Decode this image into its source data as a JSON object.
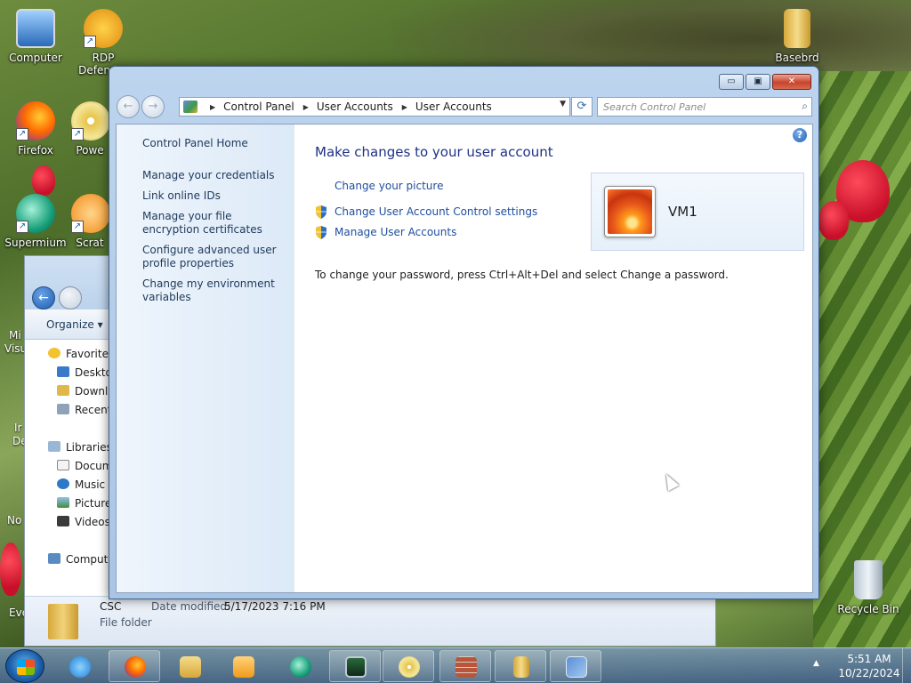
{
  "desktop": {
    "icons": [
      {
        "label": "Computer",
        "icon": "computer-icon"
      },
      {
        "label": "RDP Defender",
        "icon": "rdp-defender-icon"
      },
      {
        "label": "Basebrd",
        "icon": "folder-icon"
      },
      {
        "label": "Firefox",
        "icon": "firefox-icon"
      },
      {
        "label": "Powe",
        "icon": "cd-icon"
      },
      {
        "label": "Supermium",
        "icon": "supermium-icon"
      },
      {
        "label": "Scrat",
        "icon": "scratch-icon"
      },
      {
        "label": "Recycle Bin",
        "icon": "recycle-bin-icon"
      }
    ],
    "edge_labels": [
      "Mi",
      "Visu",
      "Ir",
      "De",
      "No",
      "Eve"
    ]
  },
  "explorer": {
    "organize_label": "Organize",
    "nav_tree": [
      {
        "label": "Favorites",
        "icon": "star-icon"
      },
      {
        "label": "Deskto",
        "icon": "desktop-icon"
      },
      {
        "label": "Downlo",
        "icon": "downloads-icon"
      },
      {
        "label": "Recent",
        "icon": "recent-icon"
      },
      {
        "label": "Libraries",
        "icon": "libraries-icon"
      },
      {
        "label": "Docum",
        "icon": "documents-icon"
      },
      {
        "label": "Music",
        "icon": "music-icon"
      },
      {
        "label": "Picture",
        "icon": "pictures-icon"
      },
      {
        "label": "Videos",
        "icon": "videos-icon"
      },
      {
        "label": "Compute",
        "icon": "computer-icon"
      }
    ],
    "status": {
      "name": "CSC",
      "type": "File folder",
      "modified_label": "Date modified:",
      "modified_value": "5/17/2023 7:16 PM"
    }
  },
  "window": {
    "buttons": {
      "minimize": "▭",
      "maximize": "▣",
      "close": "✕"
    },
    "breadcrumb": [
      "Control Panel",
      "User Accounts",
      "User Accounts"
    ],
    "search_placeholder": "Search Control Panel",
    "sidebar": {
      "home": "Control Panel Home",
      "links": [
        "Manage your credentials",
        "Link online IDs",
        "Manage your file encryption certificates",
        "Configure advanced user profile properties",
        "Change my environment variables"
      ]
    },
    "main": {
      "heading": "Make changes to your user account",
      "tasks": [
        {
          "label": "Change your picture",
          "shield": false
        },
        {
          "label": "Change User Account Control settings",
          "shield": true
        },
        {
          "label": "Manage User Accounts",
          "shield": true
        }
      ],
      "password_note": "To change your password, press Ctrl+Alt+Del and select Change a password.",
      "account_name": "VM1"
    }
  },
  "taskbar": {
    "clock_time": "5:51 AM",
    "clock_date": "10/22/2024",
    "items": [
      {
        "icon": "internet-explorer-icon"
      },
      {
        "icon": "firefox-icon"
      },
      {
        "icon": "file-explorer-icon"
      },
      {
        "icon": "media-player-icon"
      },
      {
        "icon": "supermium-icon"
      },
      {
        "icon": "task-manager-icon"
      },
      {
        "icon": "cd-icon"
      },
      {
        "icon": "firewall-icon"
      },
      {
        "icon": "folder-icon"
      },
      {
        "icon": "control-panel-icon"
      }
    ]
  }
}
